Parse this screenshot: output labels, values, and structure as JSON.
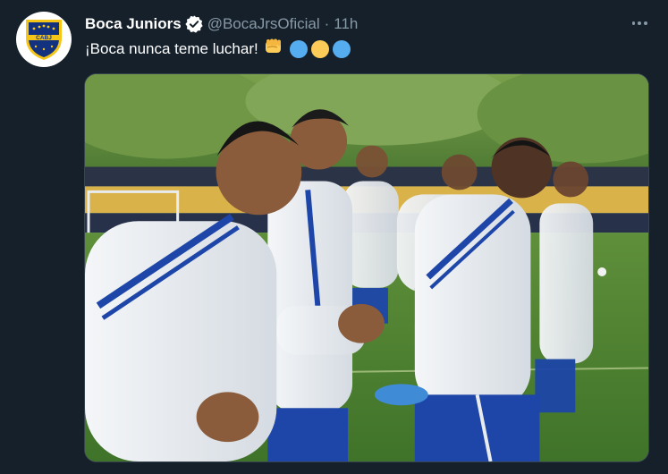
{
  "tweet": {
    "display_name": "Boca Juniors",
    "verified": true,
    "handle": "@BocaJrsOficial",
    "separator": "·",
    "time": "11h",
    "text": "¡Boca nunca teme luchar!",
    "emojis": [
      "fist-icon",
      "blue-circle-icon",
      "yellow-circle-icon",
      "blue-circle-icon"
    ],
    "more_icon": "more-horizontal-icon",
    "avatar_logo_text": "CABJ"
  },
  "colors": {
    "background": "#15202b",
    "secondary_text": "#8899a6",
    "verified_badge": "#ffffff",
    "club_blue": "#12317e",
    "club_gold": "#f5c518",
    "emoji_blue": "#55acee",
    "emoji_yellow": "#fdcb58"
  }
}
